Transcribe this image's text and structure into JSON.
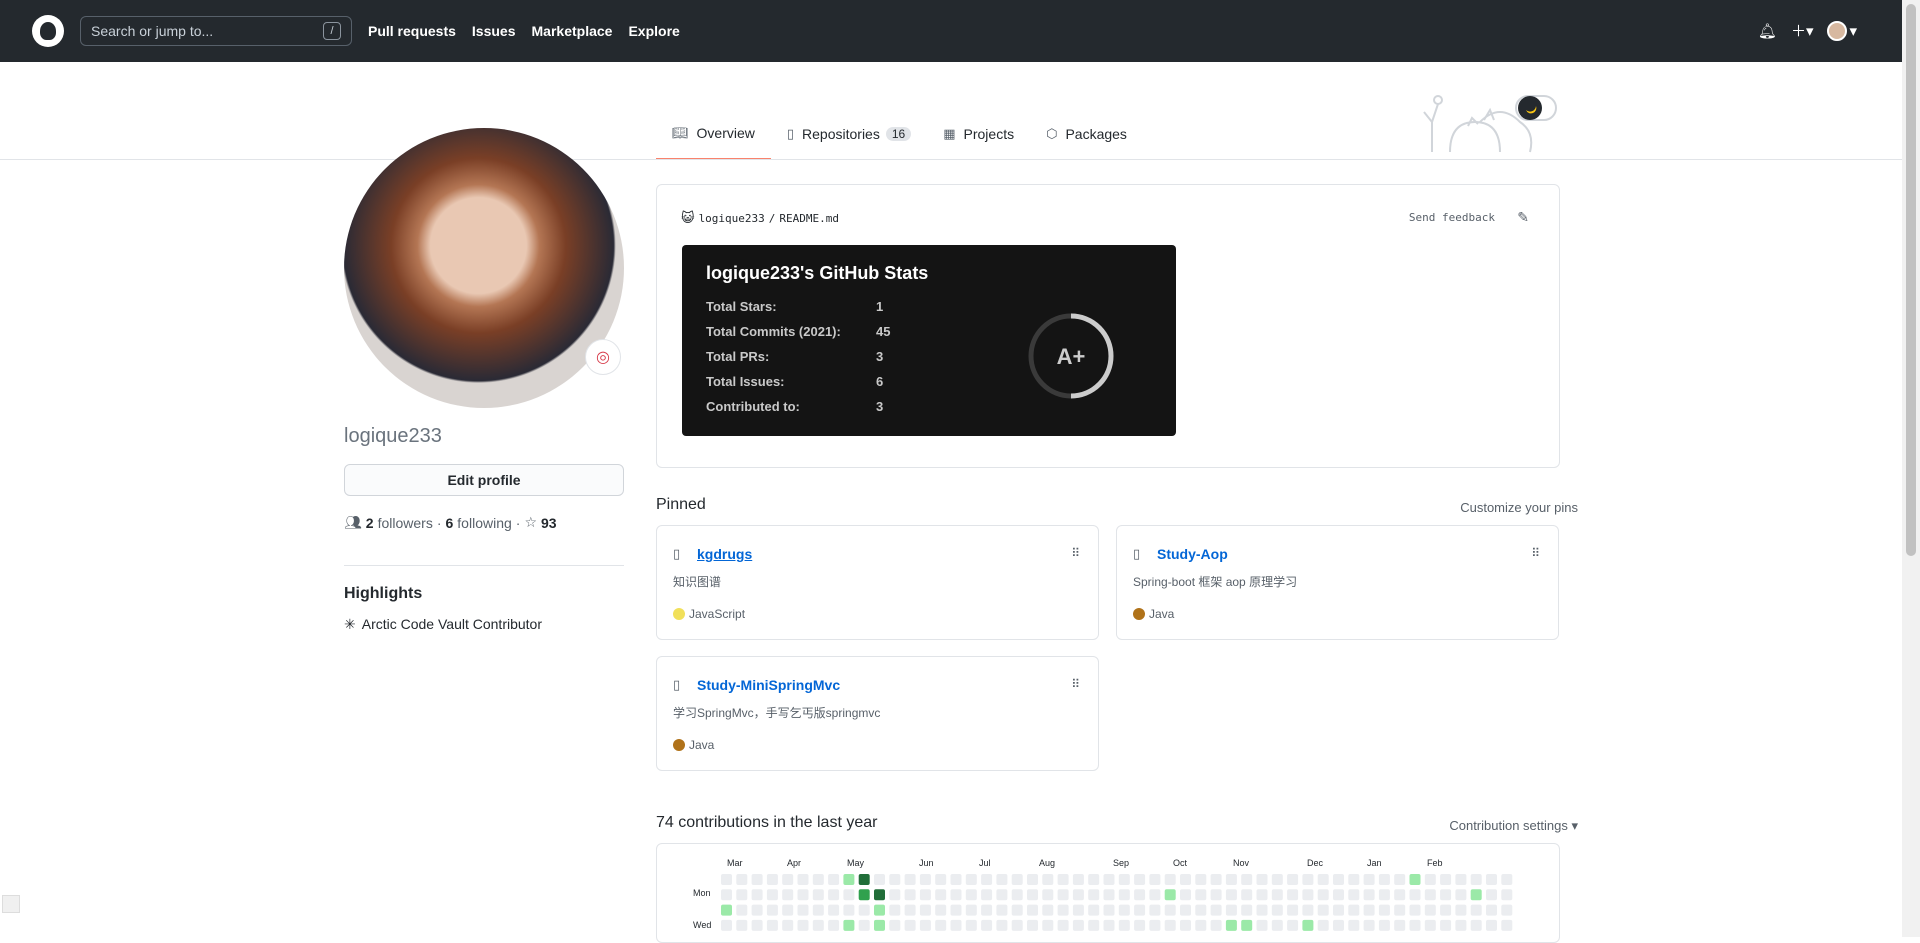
{
  "header": {
    "search_placeholder": "Search or jump to...",
    "search_shortcut": "/",
    "nav": [
      "Pull requests",
      "Issues",
      "Marketplace",
      "Explore"
    ]
  },
  "tabs": [
    {
      "label": "Overview",
      "icon": "book-icon"
    },
    {
      "label": "Repositories",
      "icon": "repo-icon",
      "count": "16"
    },
    {
      "label": "Projects",
      "icon": "project-icon"
    },
    {
      "label": "Packages",
      "icon": "package-icon"
    }
  ],
  "profile": {
    "username": "logique233",
    "edit": "Edit profile",
    "followers_count": "2",
    "followers_label": "followers",
    "following_count": "6",
    "following_label": "following",
    "stars": "93",
    "highlights_title": "Highlights",
    "highlight": "Arctic Code Vault Contributor"
  },
  "readme": {
    "owner": "logique233",
    "file": "README.md",
    "feedback": "Send feedback",
    "stats": {
      "title": "logique233's GitHub Stats",
      "rows": [
        [
          "Total Stars:",
          "1"
        ],
        [
          "Total Commits (2021):",
          "45"
        ],
        [
          "Total PRs:",
          "3"
        ],
        [
          "Total Issues:",
          "6"
        ],
        [
          "Contributed to:",
          "3"
        ]
      ],
      "grade": "A+"
    }
  },
  "pinned": {
    "title": "Pinned",
    "customize": "Customize your pins",
    "repos": [
      {
        "name": "kgdrugs",
        "desc": "知识图谱",
        "lang": "JavaScript",
        "color": "#f1e05a"
      },
      {
        "name": "Study-Aop",
        "desc": "Spring-boot 框架 aop 原理学习",
        "lang": "Java",
        "color": "#b07219"
      },
      {
        "name": "Study-MiniSpringMvc",
        "desc": "学习SpringMvc，手写乞丐版springmvc",
        "lang": "Java",
        "color": "#b07219"
      }
    ]
  },
  "contributions": {
    "title": "74 contributions in the last year",
    "settings": "Contribution settings ▾",
    "months": [
      "Mar",
      "Apr",
      "May",
      "Jun",
      "Jul",
      "Aug",
      "Sep",
      "Oct",
      "Nov",
      "Dec",
      "Jan",
      "Feb"
    ],
    "days": [
      "Mon",
      "Wed"
    ]
  }
}
